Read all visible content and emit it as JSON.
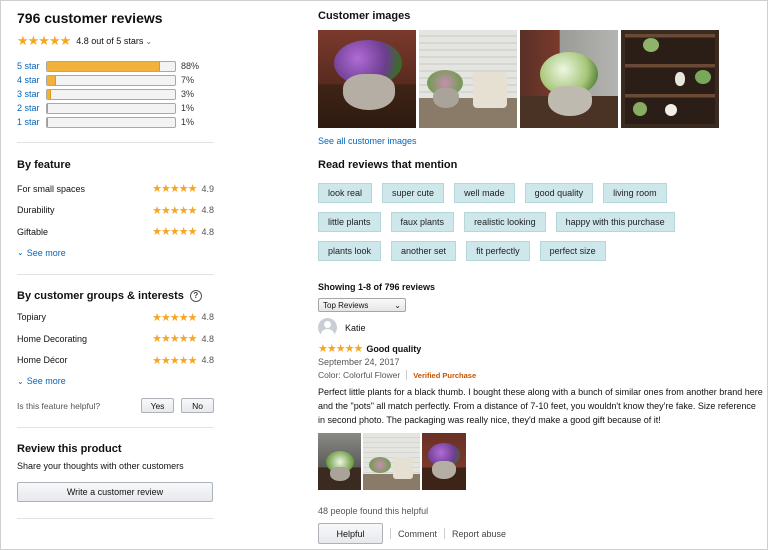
{
  "summary": {
    "title": "796 customer reviews",
    "rating_text": "4.8 out of 5 stars",
    "histogram": [
      {
        "label": "5 star",
        "percent": 88,
        "percent_text": "88%"
      },
      {
        "label": "4 star",
        "percent": 7,
        "percent_text": "7%"
      },
      {
        "label": "3 star",
        "percent": 3,
        "percent_text": "3%"
      },
      {
        "label": "2 star",
        "percent": 1,
        "percent_text": "1%"
      },
      {
        "label": "1 star",
        "percent": 1,
        "percent_text": "1%"
      }
    ]
  },
  "by_feature": {
    "title": "By feature",
    "items": [
      {
        "name": "For small spaces",
        "rating": "4.9"
      },
      {
        "name": "Durability",
        "rating": "4.8"
      },
      {
        "name": "Giftable",
        "rating": "4.8"
      }
    ],
    "see_more": "See more"
  },
  "by_groups": {
    "title": "By customer groups & interests",
    "items": [
      {
        "name": "Topiary",
        "rating": "4.8"
      },
      {
        "name": "Home Decorating",
        "rating": "4.8"
      },
      {
        "name": "Home Décor",
        "rating": "4.8"
      }
    ],
    "see_more": "See more",
    "helpful_question": "Is this feature helpful?",
    "yes_label": "Yes",
    "no_label": "No"
  },
  "review_product": {
    "title": "Review this product",
    "subtitle": "Share your thoughts with other customers",
    "button_label": "Write a customer review"
  },
  "customer_images": {
    "title": "Customer images",
    "see_all": "See all customer images"
  },
  "mentions": {
    "title": "Read reviews that mention",
    "chips": [
      "look real",
      "super cute",
      "well made",
      "good quality",
      "living room",
      "little plants",
      "faux plants",
      "realistic looking",
      "happy with this purchase",
      "plants look",
      "another set",
      "fit perfectly",
      "perfect size"
    ]
  },
  "reviews": {
    "showing": "Showing 1-8 of 796 reviews",
    "sort_label": "Top Reviews",
    "first": {
      "reviewer": "Katie",
      "title": "Good quality",
      "date": "September 24, 2017",
      "color": "Color: Colorful Flower",
      "verified": "Verified Purchase",
      "body": "Perfect little plants for a black thumb. I bought these along with a bunch of similar ones from another brand here and the \"pots\" all match perfectly. From a distance of 7-10 feet, you wouldn't know they're fake. Size reference in second photo. The packaging was really nice, they'd make a good gift because of it!",
      "found_helpful": "48 people found this helpful",
      "helpful_label": "Helpful",
      "comment_label": "Comment",
      "report_label": "Report abuse"
    }
  },
  "colors": {
    "star": "#f5a623",
    "link": "#0066c0",
    "chip_bg": "#cde7ea",
    "verified": "#c45500",
    "bar_fill": "#f0b23a"
  },
  "icons": [
    "star-icon",
    "chevron-down-icon",
    "help-circle-icon",
    "avatar-icon"
  ]
}
